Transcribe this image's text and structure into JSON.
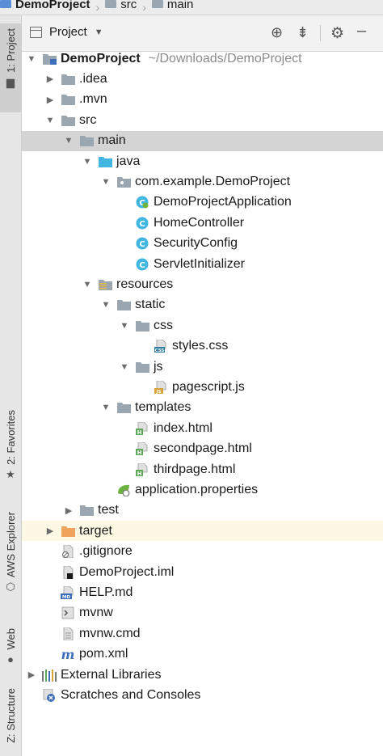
{
  "breadcrumb": [
    "DemoProject",
    "src",
    "main"
  ],
  "toolstrip": {
    "project": "1: Project",
    "favorites": "2: Favorites",
    "aws": "AWS Explorer",
    "web": "Web",
    "structure": "Z: Structure"
  },
  "panel": {
    "view": "Project"
  },
  "tree": [
    {
      "label": "DemoProject",
      "path": "~/Downloads/DemoProject",
      "depth": 0,
      "arrow": "down",
      "icon": "module-folder-icon",
      "bold": true
    },
    {
      "label": ".idea",
      "depth": 1,
      "arrow": "right",
      "icon": "folder-icon"
    },
    {
      "label": ".mvn",
      "depth": 1,
      "arrow": "right",
      "icon": "folder-icon"
    },
    {
      "label": "src",
      "depth": 1,
      "arrow": "down",
      "icon": "folder-icon"
    },
    {
      "label": "main",
      "depth": 2,
      "arrow": "down",
      "icon": "folder-icon",
      "selected": true
    },
    {
      "label": "java",
      "depth": 3,
      "arrow": "down",
      "icon": "source-folder-icon"
    },
    {
      "label": "com.example.DemoProject",
      "depth": 4,
      "arrow": "down",
      "icon": "package-icon"
    },
    {
      "label": "DemoProjectApplication",
      "depth": 5,
      "icon": "spring-class-icon"
    },
    {
      "label": "HomeController",
      "depth": 5,
      "icon": "class-icon"
    },
    {
      "label": "SecurityConfig",
      "depth": 5,
      "icon": "class-icon"
    },
    {
      "label": "ServletInitializer",
      "depth": 5,
      "icon": "class-icon"
    },
    {
      "label": "resources",
      "depth": 3,
      "arrow": "down",
      "icon": "resources-folder-icon"
    },
    {
      "label": "static",
      "depth": 4,
      "arrow": "down",
      "icon": "folder-icon"
    },
    {
      "label": "css",
      "depth": 5,
      "arrow": "down",
      "icon": "folder-icon"
    },
    {
      "label": "styles.css",
      "depth": 6,
      "icon": "css-file-icon"
    },
    {
      "label": "js",
      "depth": 5,
      "arrow": "down",
      "icon": "folder-icon"
    },
    {
      "label": "pagescript.js",
      "depth": 6,
      "icon": "js-file-icon"
    },
    {
      "label": "templates",
      "depth": 4,
      "arrow": "down",
      "icon": "folder-icon"
    },
    {
      "label": "index.html",
      "depth": 5,
      "icon": "html-file-icon"
    },
    {
      "label": "secondpage.html",
      "depth": 5,
      "icon": "html-file-icon"
    },
    {
      "label": "thirdpage.html",
      "depth": 5,
      "icon": "html-file-icon"
    },
    {
      "label": "application.properties",
      "depth": 4,
      "icon": "properties-file-icon"
    },
    {
      "label": "test",
      "depth": 2,
      "arrow": "right",
      "icon": "folder-icon"
    },
    {
      "label": "target",
      "depth": 1,
      "arrow": "right",
      "icon": "excluded-folder-icon",
      "excluded": true
    },
    {
      "label": ".gitignore",
      "depth": 1,
      "icon": "gitignore-file-icon"
    },
    {
      "label": "DemoProject.iml",
      "depth": 1,
      "icon": "iml-file-icon"
    },
    {
      "label": "HELP.md",
      "depth": 1,
      "icon": "md-file-icon"
    },
    {
      "label": "mvnw",
      "depth": 1,
      "icon": "shell-file-icon"
    },
    {
      "label": "mvnw.cmd",
      "depth": 1,
      "icon": "text-file-icon"
    },
    {
      "label": "pom.xml",
      "depth": 1,
      "icon": "maven-file-icon"
    },
    {
      "label": "External Libraries",
      "depth": 0,
      "arrow": "right",
      "icon": "libraries-icon"
    },
    {
      "label": "Scratches and Consoles",
      "depth": 0,
      "icon": "scratches-icon"
    }
  ],
  "colors": {
    "selected_row": "#d4d4d4",
    "excluded_row": "#fcf8e3",
    "folder": "#9aa7b0",
    "class": "#40b6e0",
    "excluded_folder": "#f0a35c"
  }
}
